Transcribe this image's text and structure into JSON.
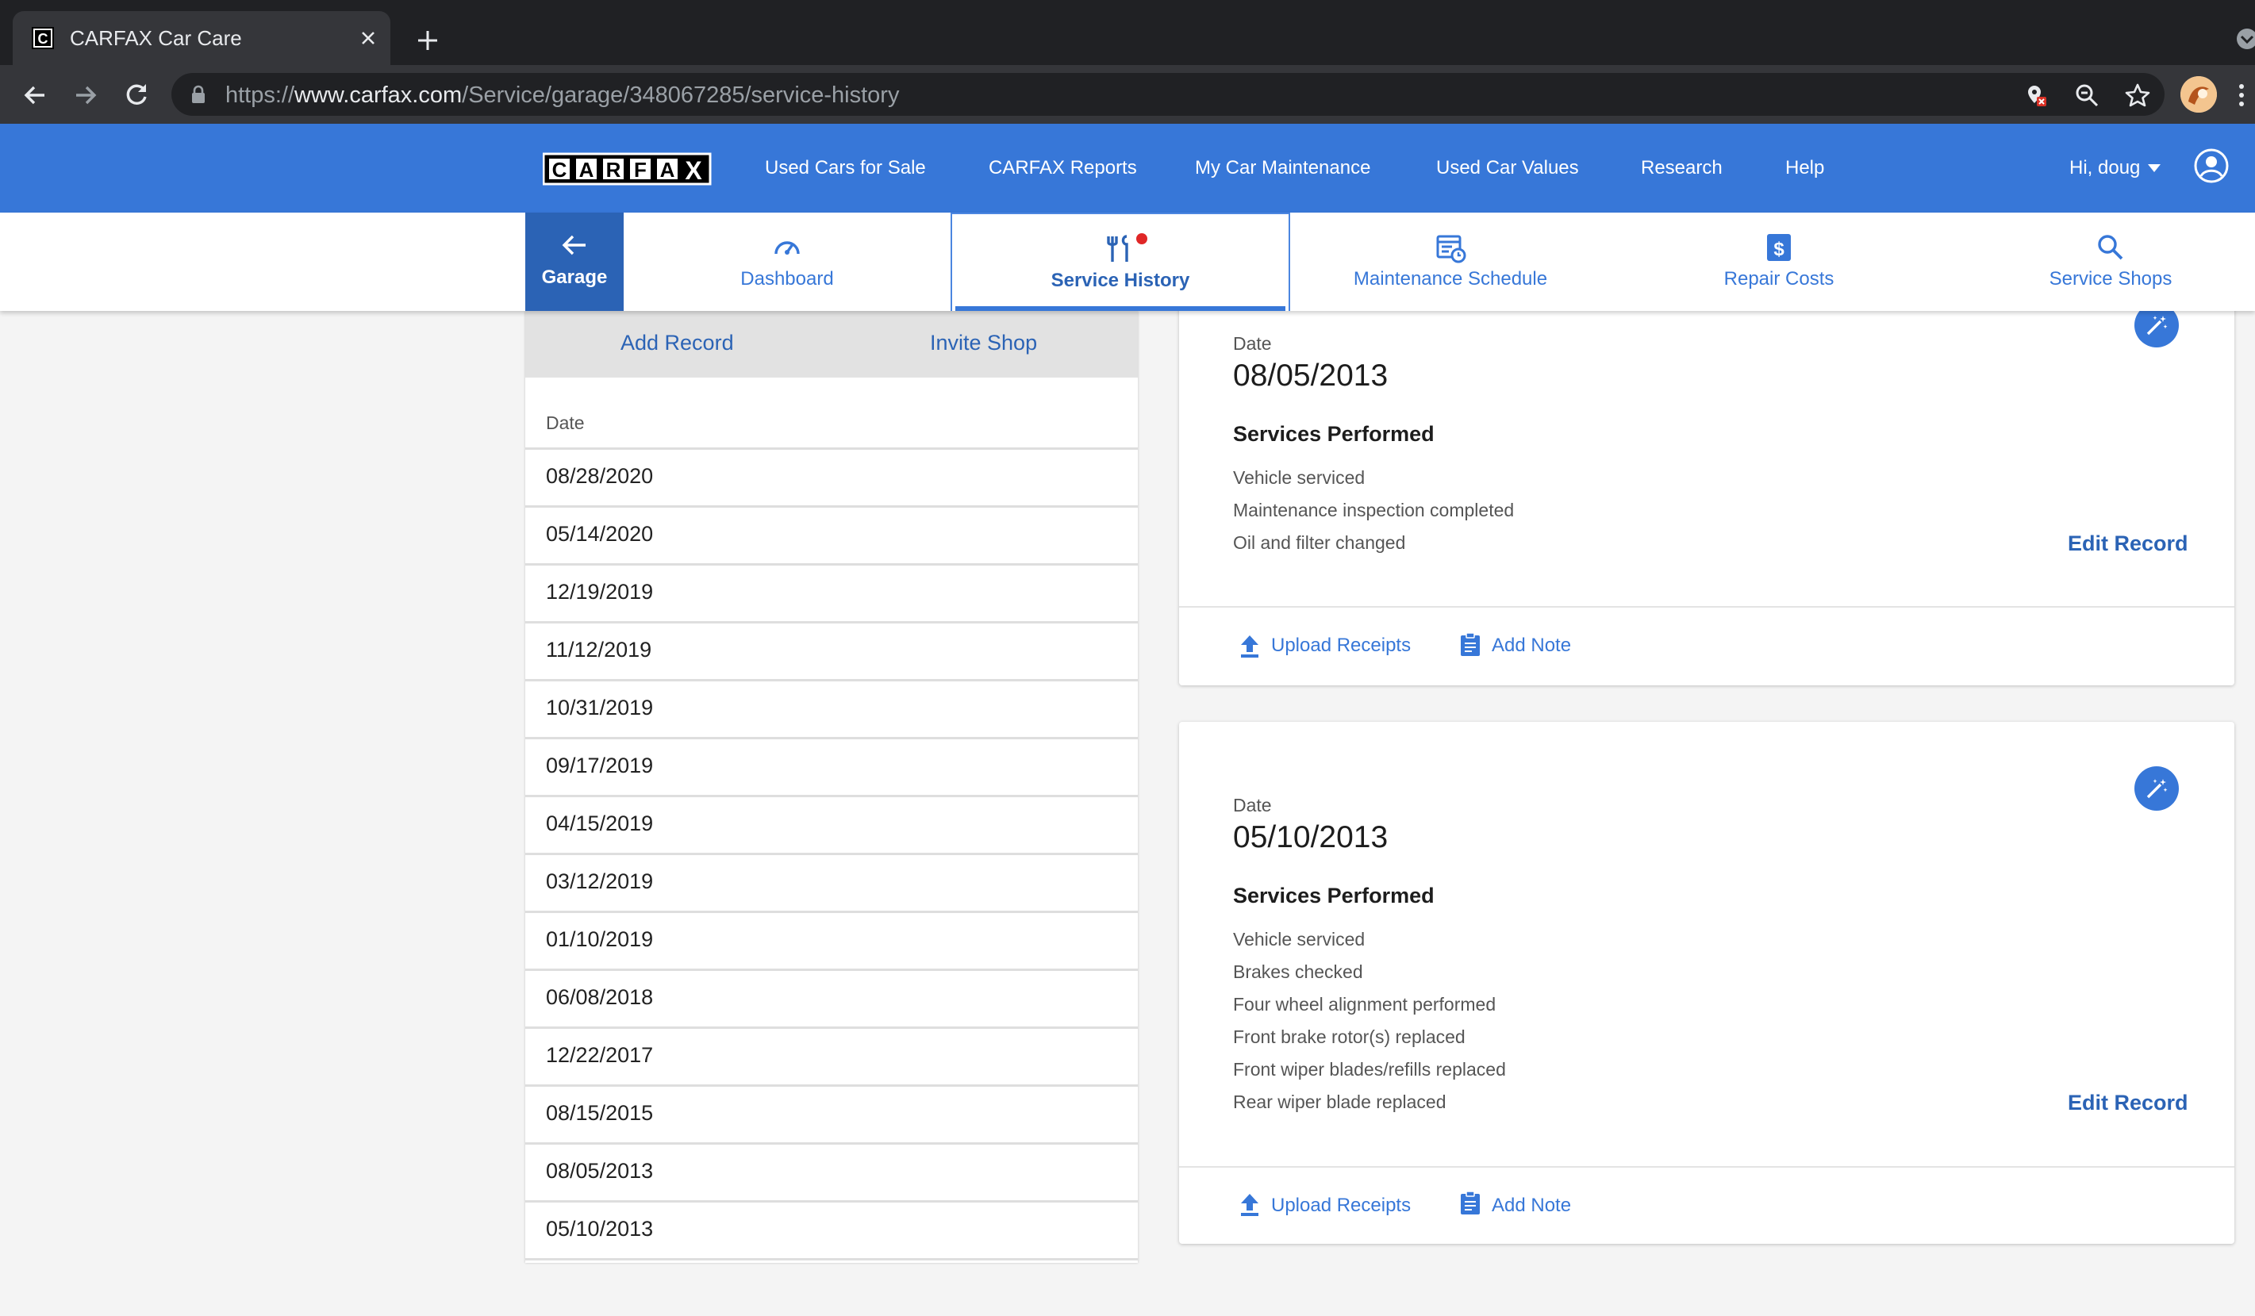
{
  "browser": {
    "tab_title": "CARFAX Car Care",
    "url_scheme": "https://",
    "url_host": "www.carfax.com",
    "url_path": "/Service/garage/348067285/service-history"
  },
  "site": {
    "logo_text": "CARFAX",
    "nav": [
      "Used Cars for Sale",
      "CARFAX Reports",
      "My Car Maintenance",
      "Used Car Values",
      "Research",
      "Help"
    ],
    "user_greeting": "Hi, doug",
    "brand_color": "#3777d8"
  },
  "subnav": {
    "garage_label": "Garage",
    "items": [
      {
        "label": "Dashboard",
        "icon": "speedometer-icon"
      },
      {
        "label": "Service History",
        "icon": "tools-icon",
        "active": true
      },
      {
        "label": "Maintenance Schedule",
        "icon": "schedule-icon"
      },
      {
        "label": "Repair Costs",
        "icon": "dollar-icon"
      },
      {
        "label": "Service Shops",
        "icon": "search-icon"
      }
    ]
  },
  "left_panel": {
    "add_record": "Add Record",
    "invite_shop": "Invite Shop",
    "list_header": "Date",
    "dates": [
      "08/28/2020",
      "05/14/2020",
      "12/19/2019",
      "11/12/2019",
      "10/31/2019",
      "09/17/2019",
      "04/15/2019",
      "03/12/2019",
      "01/10/2019",
      "06/08/2018",
      "12/22/2017",
      "08/15/2015",
      "08/05/2013",
      "05/10/2013"
    ]
  },
  "records": [
    {
      "date_label": "Date",
      "date": "08/05/2013",
      "services_title": "Services Performed",
      "services": [
        "Vehicle serviced",
        "Maintenance inspection completed",
        "Oil and filter changed"
      ],
      "edit_label": "Edit Record",
      "upload_label": "Upload Receipts",
      "note_label": "Add Note"
    },
    {
      "date_label": "Date",
      "date": "05/10/2013",
      "services_title": "Services Performed",
      "services": [
        "Vehicle serviced",
        "Brakes checked",
        "Four wheel alignment performed",
        "Front brake rotor(s) replaced",
        "Front wiper blades/refills replaced",
        "Rear wiper blade replaced"
      ],
      "edit_label": "Edit Record",
      "upload_label": "Upload Receipts",
      "note_label": "Add Note"
    }
  ]
}
